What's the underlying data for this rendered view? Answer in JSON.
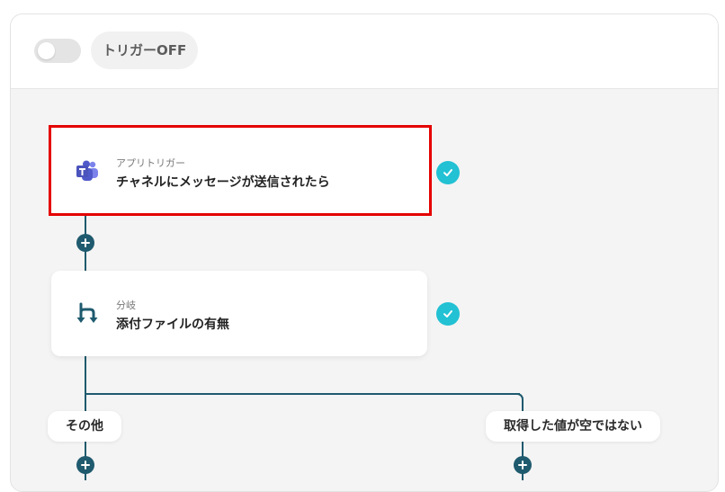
{
  "header": {
    "toggle_state": "off",
    "trigger_label": "トリガーOFF"
  },
  "flow": {
    "steps": [
      {
        "subtitle": "アプリトリガー",
        "title": "チャネルにメッセージが送信されたら",
        "icon": "microsoft-teams-icon",
        "completed": true,
        "highlighted": true
      },
      {
        "subtitle": "分岐",
        "title": "添付ファイルの有無",
        "icon": "branch-icon",
        "completed": true,
        "highlighted": false
      }
    ],
    "branches": [
      {
        "label": "その他"
      },
      {
        "label": "取得した値が空ではない"
      }
    ]
  },
  "colors": {
    "connector": "#1f5a6e",
    "check": "#22c1d3",
    "highlight": "#e50000",
    "teams_purple": "#5059c9"
  }
}
